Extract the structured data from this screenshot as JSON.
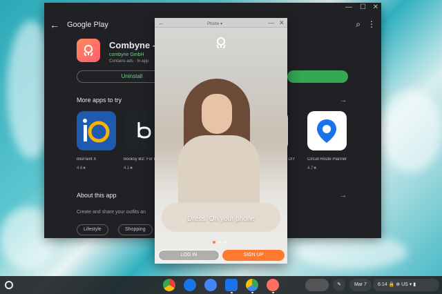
{
  "play_window": {
    "store_title": "Google Play",
    "controls": {
      "minimize": "—",
      "maximize": "☐",
      "close": "✕"
    },
    "app": {
      "name": "Combyne -",
      "developer": "combyne GmbH",
      "meta": "Contains ads · In-app",
      "uninstall_label": "Uninstall"
    },
    "more_apps_title": "More apps to try",
    "more_apps": [
      {
        "name": "ibisPaint X",
        "rating": "4.6★",
        "color": "#1e5bb0"
      },
      {
        "name": "Booksy Biz: For Businesses",
        "rating": "4.1★",
        "color": "#1f2428"
      },
      {
        "name": "...ut: DIY",
        "rating": "",
        "color": "#ffffff"
      },
      {
        "name": "Circuit Route Planner",
        "rating": "4.7★",
        "color": "#ffffff"
      }
    ],
    "about_title": "About this app",
    "about_desc": "Create and share your outfits an",
    "chips": [
      "Lifestyle",
      "Shopping"
    ]
  },
  "app_window": {
    "title": "Phone ▾",
    "tagline": "Dress. On your phone",
    "login_label": "LOG IN",
    "signup_label": "SIGN UP",
    "accent": "#ff7a2f"
  },
  "shelf": {
    "apps": [
      {
        "name": "chrome-icon",
        "color": "#dd4b39"
      },
      {
        "name": "messages-icon",
        "color": "#1a73e8"
      },
      {
        "name": "clock-icon",
        "color": "#4285f4"
      },
      {
        "name": "files-icon",
        "color": "#1a73e8"
      },
      {
        "name": "play-store-icon",
        "color": "#34a853"
      },
      {
        "name": "combyne-icon",
        "color": "#ff6f61"
      }
    ],
    "date": "Mar 7",
    "time": "6:14",
    "locale": "US"
  }
}
